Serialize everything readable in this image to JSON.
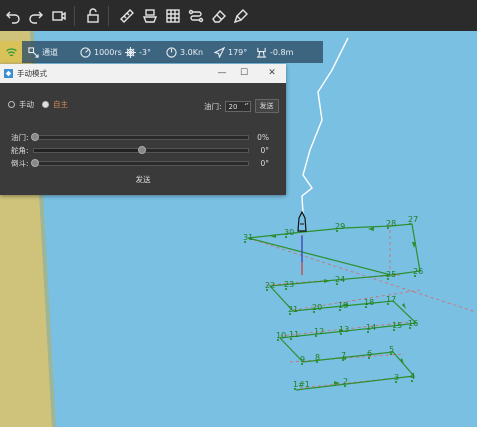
{
  "toolbar": {
    "icons": [
      "undo-icon",
      "redo-icon",
      "camera-icon",
      "lock-icon",
      "ruler-icon",
      "ship-settings-icon",
      "grid-icon",
      "route-icon",
      "eraser-icon",
      "clean-icon"
    ]
  },
  "status": {
    "route_label": "通道",
    "speed": "1000rs",
    "rudder": "-3°",
    "knots": "3.0Kn",
    "heading": "179°",
    "depth": "-0.8m"
  },
  "dialog": {
    "title": "手动模式",
    "mode_manual": "手动",
    "mode_auto": "自主",
    "throttle_label": "油门:",
    "throttle_value": "20",
    "send_label": "发送",
    "sliders": [
      {
        "label": "油门:",
        "value": "0%",
        "level": 0
      },
      {
        "label": "舵角:",
        "value": "0°",
        "level": 0.5
      },
      {
        "label": "倒斗:",
        "value": "0°",
        "level": 0
      }
    ],
    "send2_label": "发送"
  },
  "map": {
    "waypoints": [
      "1#1",
      "2",
      "3",
      "4",
      "5",
      "6",
      "7",
      "8",
      "9",
      "10",
      "11",
      "12",
      "13",
      "14",
      "15",
      "16",
      "17",
      "18",
      "19",
      "20",
      "21",
      "22",
      "23",
      "24",
      "25",
      "26",
      "27",
      "28",
      "29",
      "30",
      "31"
    ],
    "colors": {
      "water": "#79c0e3",
      "shore": "#cfc27a",
      "path": "#2d8f2d",
      "dashed": "#d06a6a"
    }
  }
}
